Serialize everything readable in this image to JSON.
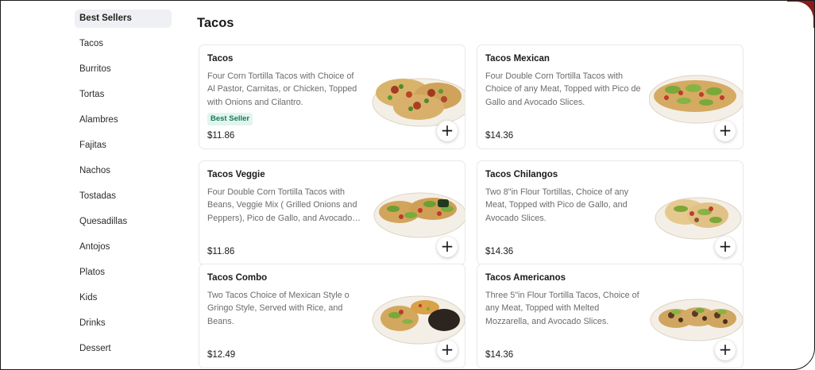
{
  "sidebar": {
    "items": [
      {
        "label": "Best Sellers",
        "active": true
      },
      {
        "label": "Tacos"
      },
      {
        "label": "Burritos"
      },
      {
        "label": "Tortas"
      },
      {
        "label": "Alambres"
      },
      {
        "label": "Fajitas"
      },
      {
        "label": "Nachos"
      },
      {
        "label": "Tostadas"
      },
      {
        "label": "Quesadillas"
      },
      {
        "label": "Antojos"
      },
      {
        "label": "Platos"
      },
      {
        "label": "Kids"
      },
      {
        "label": "Drinks"
      },
      {
        "label": "Dessert"
      }
    ]
  },
  "section": {
    "title": "Tacos"
  },
  "menu_items": [
    {
      "name": "Tacos",
      "description": "Four Corn Tortilla Tacos with Choice of Al Pastor, Carnitas, or Chicken, Topped with Onions and Cilantro.",
      "badge": "Best Seller",
      "price": "$11.86",
      "add_icon": "plus-icon"
    },
    {
      "name": "Tacos Mexican",
      "description": "Four Double Corn Tortilla Tacos with Choice of any Meat, Topped with Pico de Gallo and Avocado Slices.",
      "price": "$14.36",
      "add_icon": "plus-icon"
    },
    {
      "name": "Tacos Veggie",
      "description": "Four Double Corn Tortilla Tacos with Beans, Veggie Mix ( Grilled Onions and Peppers), Pico de Gallo, and Avocado Slices.",
      "price": "$11.86",
      "add_icon": "plus-icon"
    },
    {
      "name": "Tacos Chilangos",
      "description": "Two 8\"in Flour Tortillas, Choice of any Meat, Topped with Pico de Gallo, and Avocado Slices.",
      "price": "$14.36",
      "add_icon": "plus-icon"
    },
    {
      "name": "Tacos Combo",
      "description": "Two Tacos Choice of Mexican Style o Gringo Style, Served with Rice, and Beans.",
      "price": "$12.49",
      "add_icon": "plus-icon"
    },
    {
      "name": "Tacos Americanos",
      "description": "Three 5\"in Flour Tortilla Tacos, Choice of any Meat, Topped with Melted Mozzarella, and Avocado Slices.",
      "price": "$14.36",
      "add_icon": "plus-icon"
    }
  ],
  "add_symbol": "+"
}
